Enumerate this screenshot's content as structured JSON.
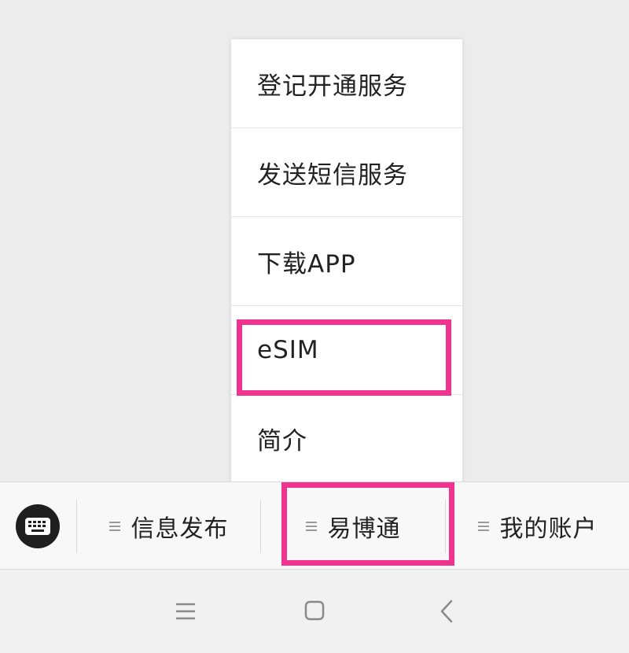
{
  "popup_menu": {
    "items": [
      {
        "label": "登记开通服务"
      },
      {
        "label": "发送短信服务"
      },
      {
        "label": "下载APP"
      },
      {
        "label": "eSIM",
        "highlighted": true
      },
      {
        "label": "简介"
      }
    ]
  },
  "menu_bar": {
    "keyboard_icon": "keyboard-icon",
    "tabs": [
      {
        "label": "信息发布",
        "icon": "menu-lines-icon"
      },
      {
        "label": "易博通",
        "icon": "menu-lines-icon",
        "highlighted": true
      },
      {
        "label": "我的账户",
        "icon": "menu-lines-icon"
      }
    ]
  },
  "nav_bar": {
    "buttons": [
      "menu-icon",
      "home-icon",
      "back-icon"
    ]
  },
  "colors": {
    "highlight": "#f0338e",
    "background": "#ececec",
    "menu_bar_bg": "#f8f8f8",
    "popup_bg": "#ffffff"
  }
}
